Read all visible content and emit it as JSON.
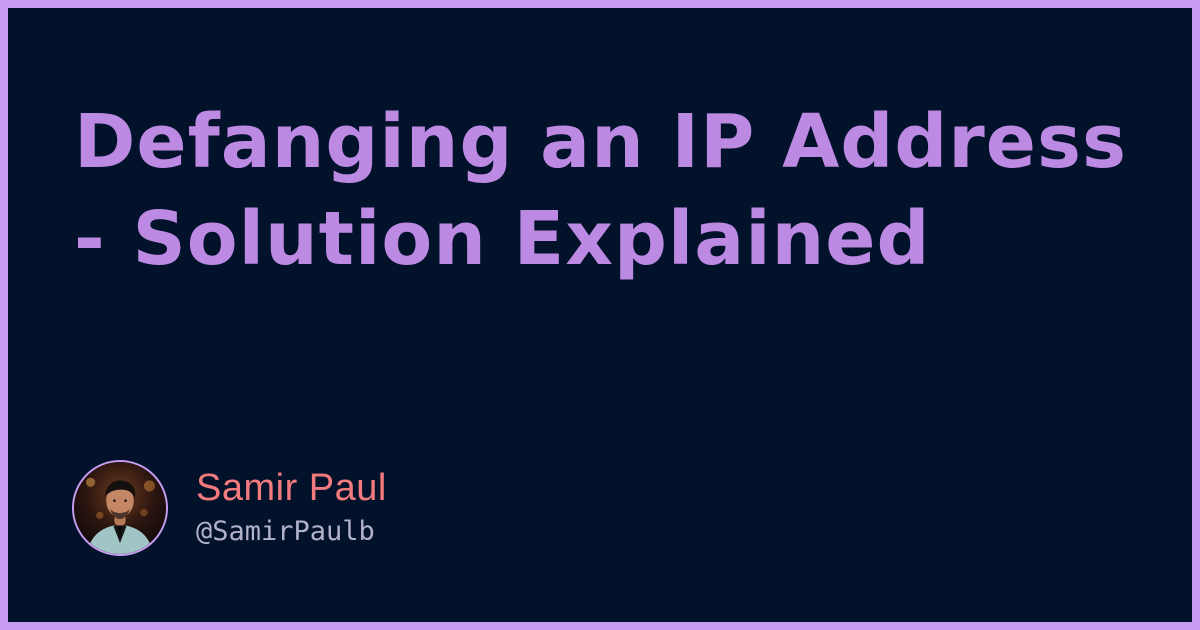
{
  "title": {
    "line1": "Defanging an IP Address",
    "line2": "- Solution Explained"
  },
  "author": {
    "name": "Samir Paul",
    "handle": "@SamirPaulb",
    "avatar_icon": "author-avatar"
  },
  "colors": {
    "frame": "#c79cf0",
    "background": "#02122b",
    "title": "#bd8ae3",
    "name": "#f37b7e",
    "handle": "#b1b2c8"
  }
}
